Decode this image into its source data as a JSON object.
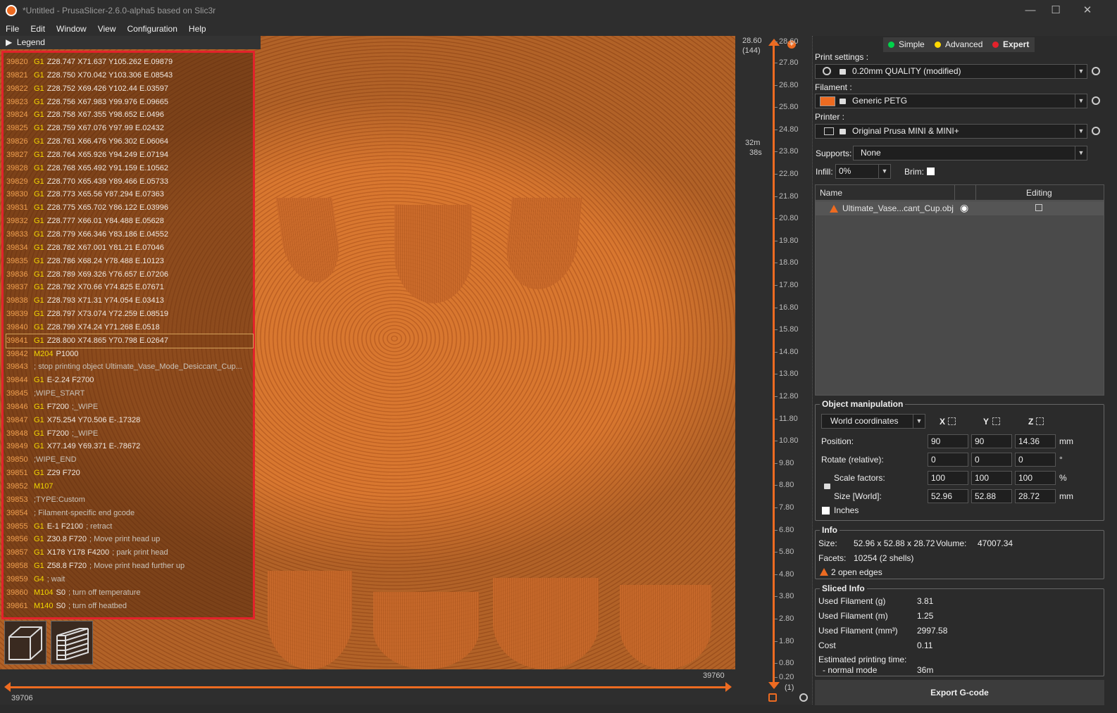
{
  "window": {
    "title": "*Untitled - PrusaSlicer-2.6.0-alpha5 based on Slic3r"
  },
  "menu": [
    "File",
    "Edit",
    "Window",
    "View",
    "Configuration",
    "Help"
  ],
  "legend": {
    "label": "Legend"
  },
  "gcode": [
    {
      "n": "39820",
      "c": "G1",
      "p": "Z28.747 X71.637 Y105.262 E.09879"
    },
    {
      "n": "39821",
      "c": "G1",
      "p": "Z28.750 X70.042 Y103.306 E.08543"
    },
    {
      "n": "39822",
      "c": "G1",
      "p": "Z28.752 X69.426 Y102.44 E.03597"
    },
    {
      "n": "39823",
      "c": "G1",
      "p": "Z28.756 X67.983 Y99.976 E.09665"
    },
    {
      "n": "39824",
      "c": "G1",
      "p": "Z28.758 X67.355 Y98.652 E.0496"
    },
    {
      "n": "39825",
      "c": "G1",
      "p": "Z28.759 X67.076 Y97.99 E.02432"
    },
    {
      "n": "39826",
      "c": "G1",
      "p": "Z28.761 X66.476 Y96.302 E.06064"
    },
    {
      "n": "39827",
      "c": "G1",
      "p": "Z28.764 X65.926 Y94.249 E.07194"
    },
    {
      "n": "39828",
      "c": "G1",
      "p": "Z28.768 X65.492 Y91.159 E.10562"
    },
    {
      "n": "39829",
      "c": "G1",
      "p": "Z28.770 X65.439 Y89.466 E.05733"
    },
    {
      "n": "39830",
      "c": "G1",
      "p": "Z28.773 X65.56 Y87.294 E.07363"
    },
    {
      "n": "39831",
      "c": "G1",
      "p": "Z28.775 X65.702 Y86.122 E.03996"
    },
    {
      "n": "39832",
      "c": "G1",
      "p": "Z28.777 X66.01 Y84.488 E.05628"
    },
    {
      "n": "39833",
      "c": "G1",
      "p": "Z28.779 X66.346 Y83.186 E.04552"
    },
    {
      "n": "39834",
      "c": "G1",
      "p": "Z28.782 X67.001 Y81.21 E.07046"
    },
    {
      "n": "39835",
      "c": "G1",
      "p": "Z28.786 X68.24 Y78.488 E.10123"
    },
    {
      "n": "39836",
      "c": "G1",
      "p": "Z28.789 X69.326 Y76.657 E.07206"
    },
    {
      "n": "39837",
      "c": "G1",
      "p": "Z28.792 X70.66 Y74.825 E.07671"
    },
    {
      "n": "39838",
      "c": "G1",
      "p": "Z28.793 X71.31 Y74.054 E.03413"
    },
    {
      "n": "39839",
      "c": "G1",
      "p": "Z28.797 X73.074 Y72.259 E.08519"
    },
    {
      "n": "39840",
      "c": "G1",
      "p": "Z28.799 X74.24 Y71.268 E.0518"
    },
    {
      "n": "39841",
      "c": "G1",
      "p": "Z28.800 X74.865 Y70.798 E.02647"
    },
    {
      "n": "39842",
      "c": "M204",
      "p": "P1000"
    },
    {
      "n": "39843",
      "c": "",
      "t": "; stop printing object Ultimate_Vase_Mode_Desiccant_Cup..."
    },
    {
      "n": "39844",
      "c": "G1",
      "p": "E-2.24 F2700"
    },
    {
      "n": "39845",
      "c": "",
      "t": ";WIPE_START"
    },
    {
      "n": "39846",
      "c": "G1",
      "p": "F7200",
      "t": ";_WIPE"
    },
    {
      "n": "39847",
      "c": "G1",
      "p": "X75.254 Y70.506 E-.17328"
    },
    {
      "n": "39848",
      "c": "G1",
      "p": "F7200",
      "t": ";_WIPE"
    },
    {
      "n": "39849",
      "c": "G1",
      "p": "X77.149 Y69.371 E-.78672"
    },
    {
      "n": "39850",
      "c": "",
      "t": ";WIPE_END"
    },
    {
      "n": "39851",
      "c": "G1",
      "p": "Z29 F720"
    },
    {
      "n": "39852",
      "c": "M107",
      "p": ""
    },
    {
      "n": "39853",
      "c": "",
      "t": ";TYPE:Custom"
    },
    {
      "n": "39854",
      "c": "",
      "t": "; Filament-specific end gcode"
    },
    {
      "n": "39855",
      "c": "G1",
      "p": "E-1 F2100",
      "t": "; retract"
    },
    {
      "n": "39856",
      "c": "G1",
      "p": "Z30.8 F720",
      "t": "; Move print head up"
    },
    {
      "n": "39857",
      "c": "G1",
      "p": "X178 Y178 F4200",
      "t": "; park print head"
    },
    {
      "n": "39858",
      "c": "G1",
      "p": "Z58.8 F720",
      "t": "; Move print head further up"
    },
    {
      "n": "39859",
      "c": "G4",
      "p": "",
      "t": "; wait"
    },
    {
      "n": "39860",
      "c": "M104",
      "p": "S0",
      "t": "; turn off temperature"
    },
    {
      "n": "39861",
      "c": "M140",
      "p": "S0",
      "t": "; turn off heatbed"
    }
  ],
  "hslider": {
    "left": "39706",
    "right": "39760"
  },
  "vslider": {
    "top_value": "28.60",
    "top_layer": "(144)",
    "time1": "32m",
    "time2": "38s",
    "bottom_layer": "(1)",
    "ticks": [
      "28.60",
      "27.80",
      "26.80",
      "25.80",
      "24.80",
      "23.80",
      "22.80",
      "21.80",
      "20.80",
      "19.80",
      "18.80",
      "17.80",
      "16.80",
      "15.80",
      "14.80",
      "13.80",
      "12.80",
      "11.80",
      "10.80",
      "9.80",
      "8.80",
      "7.80",
      "6.80",
      "5.80",
      "4.80",
      "3.80",
      "2.80",
      "1.80",
      "0.80",
      "0.20"
    ]
  },
  "modes": [
    "Simple",
    "Advanced",
    "Expert"
  ],
  "mode_colors": [
    "#00d34a",
    "#ffd800",
    "#e3222b"
  ],
  "print_settings": {
    "label": "Print settings :",
    "value": "0.20mm QUALITY (modified)"
  },
  "filament": {
    "label": "Filament :",
    "value": "Generic PETG",
    "color": "#ed6b21"
  },
  "printer": {
    "label": "Printer :",
    "value": "Original Prusa MINI & MINI+"
  },
  "supports": {
    "label": "Supports:",
    "value": "None"
  },
  "infill": {
    "label": "Infill:",
    "value": "0%"
  },
  "brim": {
    "label": "Brim:"
  },
  "objlist": {
    "col_name": "Name",
    "col_editing": "Editing",
    "object": "Ultimate_Vase...cant_Cup.obj"
  },
  "objmanip": {
    "title": "Object manipulation",
    "coords": "World coordinates",
    "x": "X",
    "y": "Y",
    "z": "Z",
    "rows": [
      {
        "label": "Position:",
        "v": [
          "90",
          "90",
          "14.36"
        ],
        "unit": "mm"
      },
      {
        "label": "Rotate (relative):",
        "v": [
          "0",
          "0",
          "0"
        ],
        "unit": "°"
      },
      {
        "label": "Scale factors:",
        "v": [
          "100",
          "100",
          "100"
        ],
        "unit": "%"
      },
      {
        "label": "Size [World]:",
        "v": [
          "52.96",
          "52.88",
          "28.72"
        ],
        "unit": "mm"
      }
    ],
    "inches": "Inches"
  },
  "info": {
    "title": "Info",
    "size_label": "Size:",
    "size": "52.96 x 52.88 x 28.72",
    "volume_label": "Volume:",
    "volume": "47007.34",
    "facets_label": "Facets:",
    "facets": "10254 (2 shells)",
    "edges": "2 open edges"
  },
  "sliced": {
    "title": "Sliced Info",
    "rows": [
      {
        "label": "Used Filament (g)",
        "value": "3.81"
      },
      {
        "label": "Used Filament (m)",
        "value": "1.25"
      },
      {
        "label": "Used Filament (mm³)",
        "value": "2997.58"
      },
      {
        "label": "Cost",
        "value": "0.11"
      }
    ],
    "time_label": "Estimated printing time:",
    "mode_label": "- normal mode",
    "mode_value": "36m"
  },
  "export": "Export G-code"
}
